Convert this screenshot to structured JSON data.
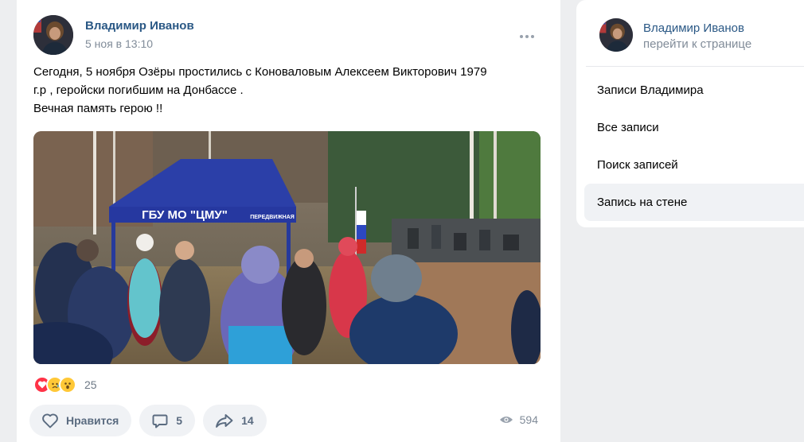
{
  "post": {
    "author": "Владимир Иванов",
    "date": "5 ноя в 13:10",
    "text_lines": [
      "Сегодня, 5 ноября Озёры простились с Коноваловым Алексеем Викторович 1979",
      "г.р , геройски погибшим на Донбассе .",
      "Вечная память герою !!"
    ],
    "photo": {
      "tent_text": "ГБУ МО \"ЦМУ\"",
      "tent_side_text": "ПЕРЕДВИЖНАЯ"
    },
    "reactions": {
      "icons": [
        "heart-icon",
        "sad-face-icon",
        "wow-face-icon"
      ],
      "count": "25"
    },
    "actions": {
      "like_label": "Нравится",
      "comments_count": "5",
      "shares_count": "14"
    },
    "views": "594"
  },
  "sidebar": {
    "name": "Владимир Иванов",
    "link": "перейти к странице",
    "menu": [
      "Записи Владимира",
      "Все записи",
      "Поиск записей",
      "Запись на стене"
    ],
    "active_item": "Запись на стене"
  },
  "colors": {
    "link": "#2a5885",
    "secondary": "#818c99",
    "heart": "#ff3347",
    "emoji": "#ffc837",
    "tent": "#2b3fa8"
  }
}
